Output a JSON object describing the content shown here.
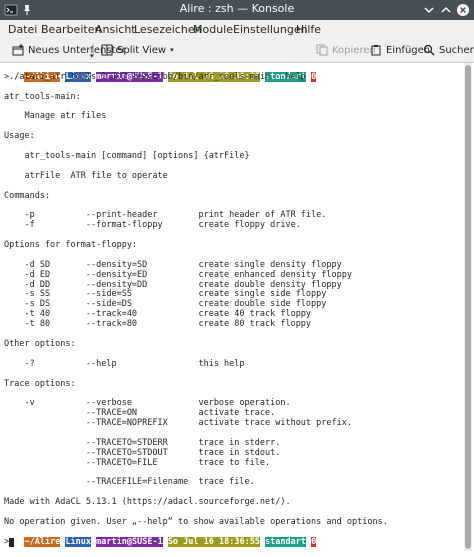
{
  "window": {
    "title": "Alire : zsh — Konsole"
  },
  "menubar": {
    "items": [
      "Datei",
      "Bearbeiten",
      "Ansicht",
      "Lesezeichen",
      "Module",
      "Einstellungen",
      "Hilfe"
    ]
  },
  "toolbar": {
    "new_tab": "Neues Unterfenster",
    "split_view": "Split View",
    "copy": "Kopieren",
    "paste": "Einfügen",
    "find": "Suchen"
  },
  "colors": {
    "prompt_dir": "#cc6a1e",
    "prompt_os": "#2b62b4",
    "prompt_user": "#7a2aa6",
    "prompt_date": "#9e9a1c",
    "prompt_branch": "#16a085",
    "prompt_status": "#c0392b"
  },
  "prompt1": {
    "dir": "~/Alire",
    "os": "Linux",
    "user": "martin@SUSE-1",
    "date": "So Jul 16 18:36:35",
    "branch": "standart",
    "status": "0"
  },
  "prompt2": {
    "dir": "~/Alire",
    "os": "Linux",
    "user": "martin@SUSE-1",
    "date": "So Jul 16 18:36:55",
    "branch": "standart",
    "status": "0"
  },
  "output": [
    ">./atari_atr_tools_1.1.3_1e2cccbb/bin/atr_tools-main --help",
    "",
    "atr_tools-main:",
    "",
    "    Manage atr files",
    "",
    "Usage:",
    "",
    "    atr_tools-main [command] [options] {atrFile}",
    "",
    "    atrFile  ATR file to operate",
    "",
    "Commands:",
    "",
    "    -p          --print-header        print header of ATR file.",
    "    -f          --format-floppy       create floppy drive.",
    "",
    "Options for format-floppy:",
    "",
    "    -d SD       --density=SD          create single density floppy",
    "    -d ED       --density=ED          create enhanced density floppy",
    "    -d DD       --density=DD          create double density floppy",
    "    -s SS       --side=SS             create single side floppy",
    "    -s DS       --side=DS             create double side floppy",
    "    -t 40       --track=40            create 40 track floppy",
    "    -t 80       --track=80            create 80 track floppy",
    "",
    "Other options:",
    "",
    "    -?          --help                this help",
    "",
    "Trace options:",
    "",
    "    -v          --verbose             verbose operation.",
    "                --TRACE=ON            activate trace.",
    "                --TRACE=NOPREFIX      activate trace without prefix.",
    "",
    "                --TRACETO=STDERR      trace in stderr.",
    "                --TRACETO=STDOUT      trace in stdout.",
    "                --TRACETO=FILE        trace to file.",
    "",
    "                --TRACEFILE=Filename  trace file.",
    "",
    "Made with AdaCL 5.13.1 (https://adacl.sourceforge.net/).",
    "",
    "No operation given. User „--help“ to show available operations and options."
  ]
}
